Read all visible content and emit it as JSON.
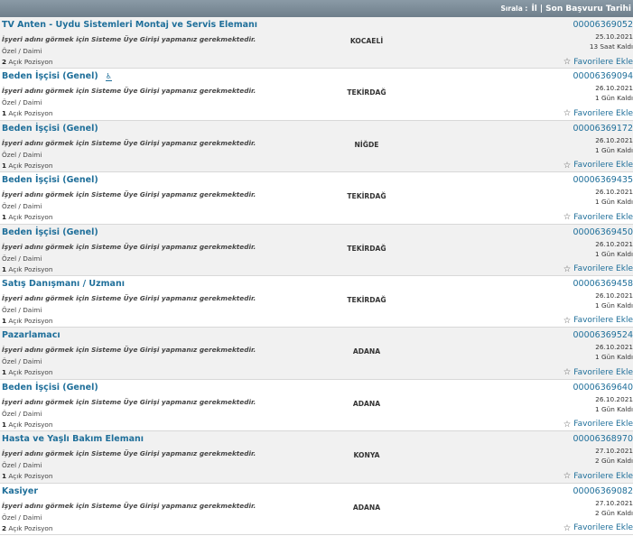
{
  "header": {
    "sort_label": "Sırala :",
    "sort_city": "İl",
    "separator": "|",
    "sort_deadline": "Son Başvuru Tarihi"
  },
  "common": {
    "employer_note": "İşyeri adını görmek için Sisteme Üye Girişi yapmanız gerekmektedir.",
    "work_type": "Özel / Daimi",
    "positions_suffix": "Açık Pozisyon",
    "favorite_label": "Favorilere Ekle",
    "disabled_icon_glyph": "♿"
  },
  "jobs": [
    {
      "title": "TV Anten - Uydu Sistemleri Montaj ve Servis Elemanı",
      "positions": "2",
      "city": "KOCAELİ",
      "ilan_no": "00006369052",
      "date": "25.10.2021",
      "remaining": "13 Saat Kaldı",
      "disabled_icon": false
    },
    {
      "title": "Beden İşçisi (Genel)",
      "positions": "1",
      "city": "TEKİRDAĞ",
      "ilan_no": "00006369094",
      "date": "26.10.2021",
      "remaining": "1 Gün Kaldı",
      "disabled_icon": true
    },
    {
      "title": "Beden İşçisi (Genel)",
      "positions": "1",
      "city": "NİĞDE",
      "ilan_no": "00006369172",
      "date": "26.10.2021",
      "remaining": "1 Gün Kaldı",
      "disabled_icon": false
    },
    {
      "title": "Beden İşçisi (Genel)",
      "positions": "1",
      "city": "TEKİRDAĞ",
      "ilan_no": "00006369435",
      "date": "26.10.2021",
      "remaining": "1 Gün Kaldı",
      "disabled_icon": false
    },
    {
      "title": "Beden İşçisi (Genel)",
      "positions": "1",
      "city": "TEKİRDAĞ",
      "ilan_no": "00006369450",
      "date": "26.10.2021",
      "remaining": "1 Gün Kaldı",
      "disabled_icon": false
    },
    {
      "title": "Satış Danışmanı / Uzmanı",
      "positions": "1",
      "city": "TEKİRDAĞ",
      "ilan_no": "00006369458",
      "date": "26.10.2021",
      "remaining": "1 Gün Kaldı",
      "disabled_icon": false
    },
    {
      "title": "Pazarlamacı",
      "positions": "1",
      "city": "ADANA",
      "ilan_no": "00006369524",
      "date": "26.10.2021",
      "remaining": "1 Gün Kaldı",
      "disabled_icon": false
    },
    {
      "title": "Beden İşçisi (Genel)",
      "positions": "1",
      "city": "ADANA",
      "ilan_no": "00006369640",
      "date": "26.10.2021",
      "remaining": "1 Gün Kaldı",
      "disabled_icon": false
    },
    {
      "title": "Hasta ve Yaşlı Bakım Elemanı",
      "positions": "1",
      "city": "KONYA",
      "ilan_no": "00006368970",
      "date": "27.10.2021",
      "remaining": "2 Gün Kaldı",
      "disabled_icon": false
    },
    {
      "title": "Kasiyer",
      "positions": "2",
      "city": "ADANA",
      "ilan_no": "00006369082",
      "date": "27.10.2021",
      "remaining": "2 Gün Kaldı",
      "disabled_icon": false
    }
  ]
}
